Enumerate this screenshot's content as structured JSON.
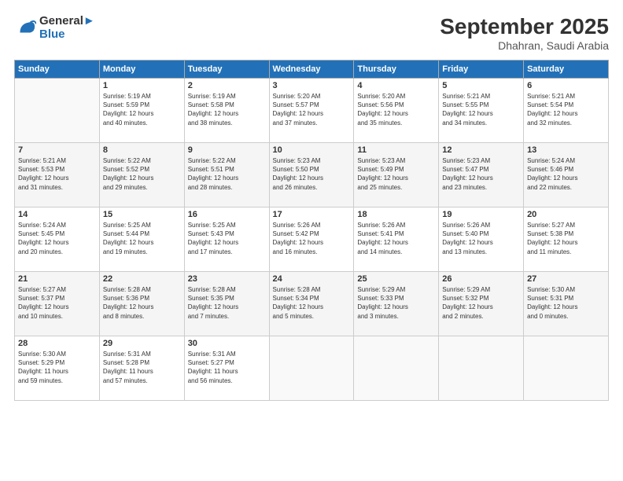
{
  "header": {
    "logo_line1": "General",
    "logo_line2": "Blue",
    "month": "September 2025",
    "location": "Dhahran, Saudi Arabia"
  },
  "weekdays": [
    "Sunday",
    "Monday",
    "Tuesday",
    "Wednesday",
    "Thursday",
    "Friday",
    "Saturday"
  ],
  "weeks": [
    [
      {
        "day": "",
        "info": ""
      },
      {
        "day": "1",
        "info": "Sunrise: 5:19 AM\nSunset: 5:59 PM\nDaylight: 12 hours\nand 40 minutes."
      },
      {
        "day": "2",
        "info": "Sunrise: 5:19 AM\nSunset: 5:58 PM\nDaylight: 12 hours\nand 38 minutes."
      },
      {
        "day": "3",
        "info": "Sunrise: 5:20 AM\nSunset: 5:57 PM\nDaylight: 12 hours\nand 37 minutes."
      },
      {
        "day": "4",
        "info": "Sunrise: 5:20 AM\nSunset: 5:56 PM\nDaylight: 12 hours\nand 35 minutes."
      },
      {
        "day": "5",
        "info": "Sunrise: 5:21 AM\nSunset: 5:55 PM\nDaylight: 12 hours\nand 34 minutes."
      },
      {
        "day": "6",
        "info": "Sunrise: 5:21 AM\nSunset: 5:54 PM\nDaylight: 12 hours\nand 32 minutes."
      }
    ],
    [
      {
        "day": "7",
        "info": "Sunrise: 5:21 AM\nSunset: 5:53 PM\nDaylight: 12 hours\nand 31 minutes."
      },
      {
        "day": "8",
        "info": "Sunrise: 5:22 AM\nSunset: 5:52 PM\nDaylight: 12 hours\nand 29 minutes."
      },
      {
        "day": "9",
        "info": "Sunrise: 5:22 AM\nSunset: 5:51 PM\nDaylight: 12 hours\nand 28 minutes."
      },
      {
        "day": "10",
        "info": "Sunrise: 5:23 AM\nSunset: 5:50 PM\nDaylight: 12 hours\nand 26 minutes."
      },
      {
        "day": "11",
        "info": "Sunrise: 5:23 AM\nSunset: 5:49 PM\nDaylight: 12 hours\nand 25 minutes."
      },
      {
        "day": "12",
        "info": "Sunrise: 5:23 AM\nSunset: 5:47 PM\nDaylight: 12 hours\nand 23 minutes."
      },
      {
        "day": "13",
        "info": "Sunrise: 5:24 AM\nSunset: 5:46 PM\nDaylight: 12 hours\nand 22 minutes."
      }
    ],
    [
      {
        "day": "14",
        "info": "Sunrise: 5:24 AM\nSunset: 5:45 PM\nDaylight: 12 hours\nand 20 minutes."
      },
      {
        "day": "15",
        "info": "Sunrise: 5:25 AM\nSunset: 5:44 PM\nDaylight: 12 hours\nand 19 minutes."
      },
      {
        "day": "16",
        "info": "Sunrise: 5:25 AM\nSunset: 5:43 PM\nDaylight: 12 hours\nand 17 minutes."
      },
      {
        "day": "17",
        "info": "Sunrise: 5:26 AM\nSunset: 5:42 PM\nDaylight: 12 hours\nand 16 minutes."
      },
      {
        "day": "18",
        "info": "Sunrise: 5:26 AM\nSunset: 5:41 PM\nDaylight: 12 hours\nand 14 minutes."
      },
      {
        "day": "19",
        "info": "Sunrise: 5:26 AM\nSunset: 5:40 PM\nDaylight: 12 hours\nand 13 minutes."
      },
      {
        "day": "20",
        "info": "Sunrise: 5:27 AM\nSunset: 5:38 PM\nDaylight: 12 hours\nand 11 minutes."
      }
    ],
    [
      {
        "day": "21",
        "info": "Sunrise: 5:27 AM\nSunset: 5:37 PM\nDaylight: 12 hours\nand 10 minutes."
      },
      {
        "day": "22",
        "info": "Sunrise: 5:28 AM\nSunset: 5:36 PM\nDaylight: 12 hours\nand 8 minutes."
      },
      {
        "day": "23",
        "info": "Sunrise: 5:28 AM\nSunset: 5:35 PM\nDaylight: 12 hours\nand 7 minutes."
      },
      {
        "day": "24",
        "info": "Sunrise: 5:28 AM\nSunset: 5:34 PM\nDaylight: 12 hours\nand 5 minutes."
      },
      {
        "day": "25",
        "info": "Sunrise: 5:29 AM\nSunset: 5:33 PM\nDaylight: 12 hours\nand 3 minutes."
      },
      {
        "day": "26",
        "info": "Sunrise: 5:29 AM\nSunset: 5:32 PM\nDaylight: 12 hours\nand 2 minutes."
      },
      {
        "day": "27",
        "info": "Sunrise: 5:30 AM\nSunset: 5:31 PM\nDaylight: 12 hours\nand 0 minutes."
      }
    ],
    [
      {
        "day": "28",
        "info": "Sunrise: 5:30 AM\nSunset: 5:29 PM\nDaylight: 11 hours\nand 59 minutes."
      },
      {
        "day": "29",
        "info": "Sunrise: 5:31 AM\nSunset: 5:28 PM\nDaylight: 11 hours\nand 57 minutes."
      },
      {
        "day": "30",
        "info": "Sunrise: 5:31 AM\nSunset: 5:27 PM\nDaylight: 11 hours\nand 56 minutes."
      },
      {
        "day": "",
        "info": ""
      },
      {
        "day": "",
        "info": ""
      },
      {
        "day": "",
        "info": ""
      },
      {
        "day": "",
        "info": ""
      }
    ]
  ]
}
